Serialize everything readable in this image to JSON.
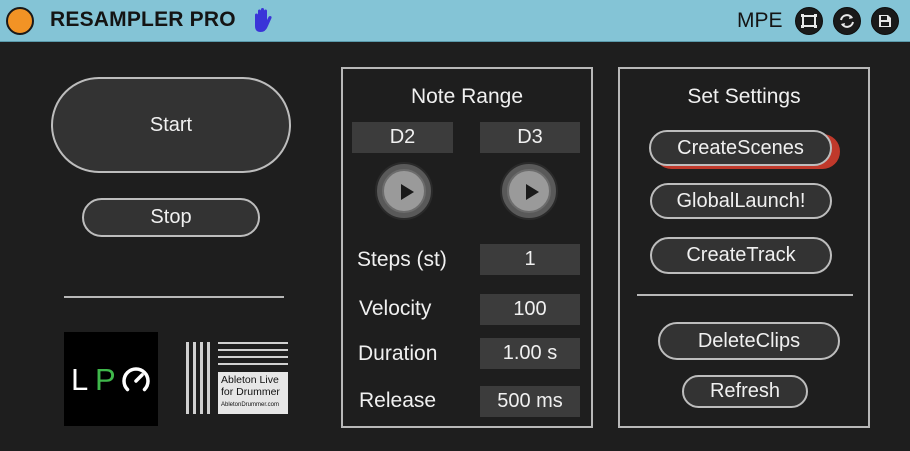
{
  "titlebar": {
    "title": "RESAMPLER PRO",
    "mode_label": "MPE",
    "icons": [
      "power-icon",
      "hand-icon",
      "maximize-icon",
      "sync-icon",
      "save-icon"
    ],
    "colors": {
      "bar": "#84c4d6",
      "power": "#f29325",
      "hand": "#3a34d8"
    }
  },
  "left": {
    "start_label": "Start",
    "stop_label": "Stop",
    "logo_lpo": {
      "l": "L",
      "p": "P"
    },
    "logo_ableton": {
      "line1": "Ableton Live",
      "line2": "for Drummer",
      "line3": "AbletonDrummer.com"
    }
  },
  "note_range": {
    "title": "Note Range",
    "low_note": "D2",
    "high_note": "D3",
    "params": [
      {
        "label": "Steps (st)",
        "value": "1"
      },
      {
        "label": "Velocity",
        "value": "100"
      },
      {
        "label": "Duration",
        "value": "1.00 s"
      },
      {
        "label": "Release",
        "value": "500 ms"
      }
    ]
  },
  "set_settings": {
    "title": "Set Settings",
    "buttons": {
      "create_scenes": "CreateScenes",
      "global_launch": "GlobalLaunch!",
      "create_track": "CreateTrack",
      "delete_clips": "DeleteClips",
      "refresh": "Refresh"
    },
    "accent_color": "#c0392b"
  }
}
